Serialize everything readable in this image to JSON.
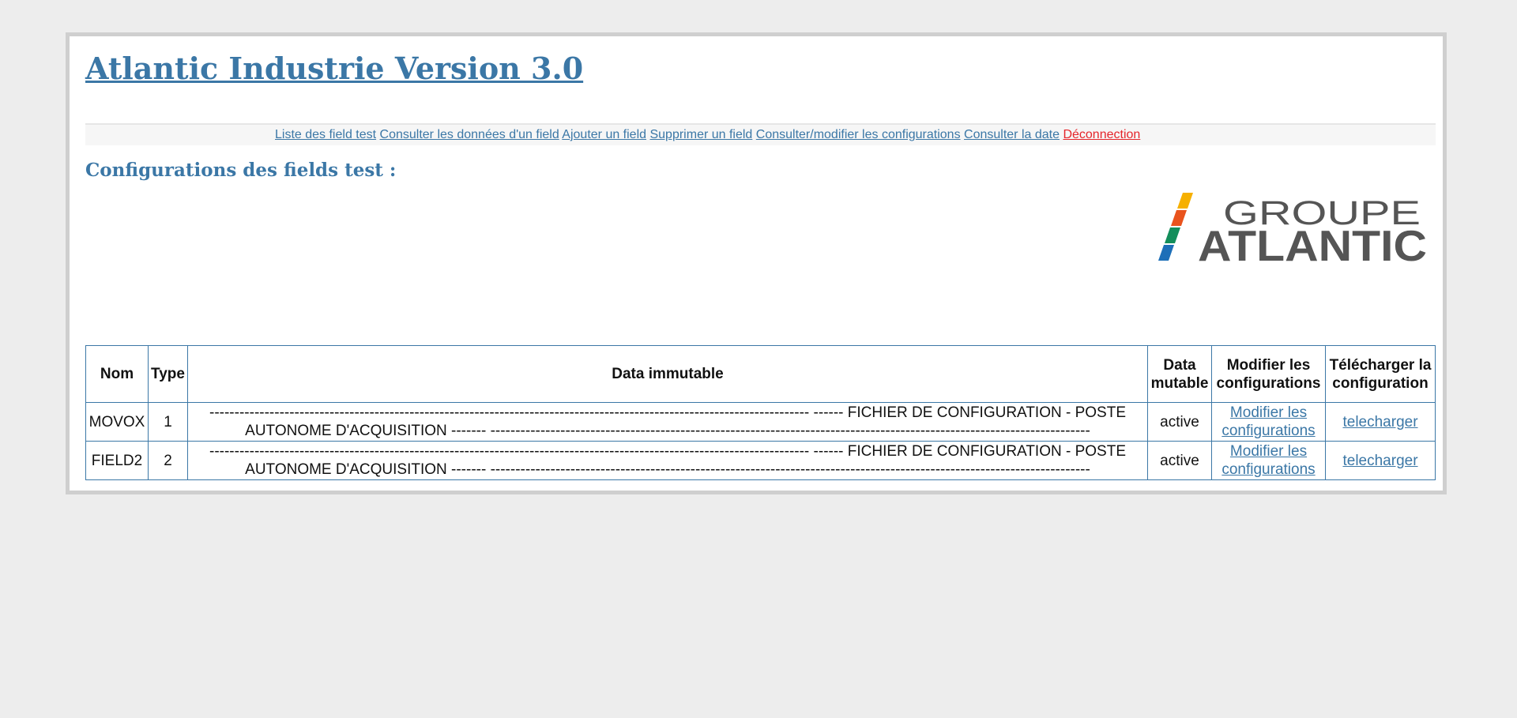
{
  "header": {
    "title": "Atlantic Industrie Version 3.0"
  },
  "nav": {
    "links": [
      "Liste des field test",
      "Consulter les données d'un field",
      "Ajouter un field",
      "Supprimer un field",
      "Consulter/modifier les configurations",
      "Consulter la date"
    ],
    "logout": "Déconnection"
  },
  "section": {
    "title": "Configurations des fields test :"
  },
  "logo": {
    "line1": "GROUPE",
    "line2": "ATLANTIC",
    "stripe_colors": [
      "#f6b000",
      "#e9531d",
      "#138e5b",
      "#1d6fb8"
    ],
    "text_color": "#555555"
  },
  "table": {
    "headers": {
      "nom": "Nom",
      "type": "Type",
      "immutable": "Data immutable",
      "mutable": "Data mutable",
      "modifier": "Modifier les configurations",
      "telecharger": "Télécharger la configuration"
    },
    "rows": [
      {
        "nom": "MOVOX",
        "type": "1",
        "immutable": "------------------------------------------------------------------------------------------------------------------------ ------ FICHIER DE CONFIGURATION - POSTE AUTONOME D'ACQUISITION ------- ------------------------------------------------------------------------------------------------------------------------",
        "mutable": "active",
        "modifier": "Modifier les configurations",
        "telecharger": "telecharger"
      },
      {
        "nom": "FIELD2",
        "type": "2",
        "immutable": "------------------------------------------------------------------------------------------------------------------------ ------ FICHIER DE CONFIGURATION - POSTE AUTONOME D'ACQUISITION ------- ------------------------------------------------------------------------------------------------------------------------",
        "mutable": "active",
        "modifier": "Modifier les configurations",
        "telecharger": "telecharger"
      }
    ]
  },
  "colors": {
    "accent": "#3b77a6",
    "logout": "#e5252a",
    "page_background": "#ededed",
    "frame_border": "#cfcfcf"
  }
}
